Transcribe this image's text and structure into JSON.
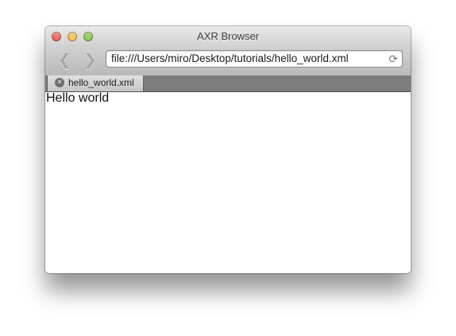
{
  "window": {
    "title": "AXR Browser"
  },
  "toolbar": {
    "back_icon": "chevron-left-icon",
    "forward_icon": "chevron-right-icon",
    "address": "file:///Users/miro/Desktop/tutorials/hello_world.xml",
    "reload_icon": "reload-icon"
  },
  "tabs": [
    {
      "label": "hello_world.xml",
      "close_icon": "close-circle-icon"
    }
  ],
  "content": {
    "text": "Hello world"
  }
}
